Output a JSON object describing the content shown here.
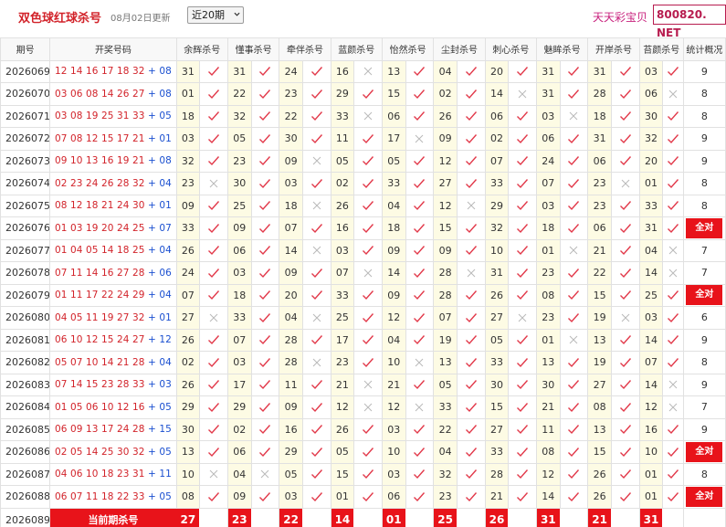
{
  "header": {
    "title": "双色球红球杀号",
    "updated": "08月02日更新",
    "period_select": "近20期",
    "site_name": "天天彩宝贝",
    "site_domain": "800820. NET"
  },
  "colors": {
    "red": "#d2232a",
    "blue": "#1a4fd0",
    "highlight": "#e8131a",
    "cell_bg": "#fdfbe4"
  },
  "columns": [
    "期号",
    "开奖号码",
    "余辉杀号",
    "懂事杀号",
    "牵伴杀号",
    "蓝颜杀号",
    "怡然杀号",
    "尘封杀号",
    "刺心杀号",
    "魅眸杀号",
    "开岸杀号",
    "苔颜杀号",
    "统计概况"
  ],
  "rows": [
    {
      "issue": "2026069",
      "red": "12 14 16 17 18 32",
      "blue": "08",
      "picks": [
        "31",
        "31",
        "24",
        "16",
        "13",
        "04",
        "20",
        "31",
        "31",
        "03"
      ],
      "marks": [
        1,
        1,
        1,
        0,
        1,
        1,
        1,
        1,
        1,
        1
      ],
      "stat": "9"
    },
    {
      "issue": "2026070",
      "red": "03 06 08 14 26 27",
      "blue": "08",
      "picks": [
        "01",
        "22",
        "23",
        "29",
        "15",
        "02",
        "14",
        "31",
        "28",
        "06"
      ],
      "marks": [
        1,
        1,
        1,
        1,
        1,
        1,
        0,
        1,
        1,
        0
      ],
      "stat": "8"
    },
    {
      "issue": "2026071",
      "red": "03 08 19 25 31 33",
      "blue": "05",
      "picks": [
        "18",
        "32",
        "22",
        "33",
        "06",
        "26",
        "06",
        "03",
        "18",
        "30"
      ],
      "marks": [
        1,
        1,
        1,
        0,
        1,
        1,
        1,
        0,
        1,
        1
      ],
      "stat": "8"
    },
    {
      "issue": "2026072",
      "red": "07 08 12 15 17 21",
      "blue": "01",
      "picks": [
        "03",
        "05",
        "30",
        "11",
        "17",
        "09",
        "02",
        "06",
        "31",
        "32"
      ],
      "marks": [
        1,
        1,
        1,
        1,
        0,
        1,
        1,
        1,
        1,
        1
      ],
      "stat": "9"
    },
    {
      "issue": "2026073",
      "red": "09 10 13 16 19 21",
      "blue": "08",
      "picks": [
        "32",
        "23",
        "09",
        "05",
        "05",
        "12",
        "07",
        "24",
        "06",
        "20"
      ],
      "marks": [
        1,
        1,
        0,
        1,
        1,
        1,
        1,
        1,
        1,
        1
      ],
      "stat": "9"
    },
    {
      "issue": "2026074",
      "red": "02 23 24 26 28 32",
      "blue": "04",
      "picks": [
        "23",
        "30",
        "03",
        "02",
        "33",
        "27",
        "33",
        "07",
        "23",
        "01"
      ],
      "marks": [
        0,
        1,
        1,
        1,
        1,
        1,
        1,
        1,
        0,
        1
      ],
      "stat": "8"
    },
    {
      "issue": "2026075",
      "red": "08 12 18 21 24 30",
      "blue": "01",
      "picks": [
        "09",
        "25",
        "18",
        "26",
        "04",
        "12",
        "29",
        "03",
        "23",
        "33"
      ],
      "marks": [
        1,
        1,
        0,
        1,
        1,
        0,
        1,
        1,
        1,
        1
      ],
      "stat": "8"
    },
    {
      "issue": "2026076",
      "red": "01 03 19 20 24 25",
      "blue": "07",
      "picks": [
        "33",
        "09",
        "07",
        "16",
        "18",
        "15",
        "32",
        "18",
        "06",
        "31"
      ],
      "marks": [
        1,
        1,
        1,
        1,
        1,
        1,
        1,
        1,
        1,
        1
      ],
      "stat": "全对"
    },
    {
      "issue": "2026077",
      "red": "01 04 05 14 18 25",
      "blue": "04",
      "picks": [
        "26",
        "06",
        "14",
        "03",
        "09",
        "09",
        "10",
        "01",
        "21",
        "04"
      ],
      "marks": [
        1,
        1,
        0,
        1,
        1,
        1,
        1,
        0,
        1,
        0
      ],
      "stat": "7"
    },
    {
      "issue": "2026078",
      "red": "07 11 14 16 27 28",
      "blue": "06",
      "picks": [
        "24",
        "03",
        "09",
        "07",
        "14",
        "28",
        "31",
        "23",
        "22",
        "14"
      ],
      "marks": [
        1,
        1,
        1,
        0,
        1,
        0,
        1,
        1,
        1,
        0
      ],
      "stat": "7"
    },
    {
      "issue": "2026079",
      "red": "01 11 17 22 24 29",
      "blue": "04",
      "picks": [
        "07",
        "18",
        "20",
        "33",
        "09",
        "28",
        "26",
        "08",
        "15",
        "25"
      ],
      "marks": [
        1,
        1,
        1,
        1,
        1,
        1,
        1,
        1,
        1,
        1
      ],
      "stat": "全对"
    },
    {
      "issue": "2026080",
      "red": "04 05 11 19 27 32",
      "blue": "01",
      "picks": [
        "27",
        "33",
        "04",
        "25",
        "12",
        "07",
        "27",
        "23",
        "19",
        "03"
      ],
      "marks": [
        0,
        1,
        0,
        1,
        1,
        1,
        0,
        1,
        0,
        1
      ],
      "stat": "6"
    },
    {
      "issue": "2026081",
      "red": "06 10 12 15 24 27",
      "blue": "12",
      "picks": [
        "26",
        "07",
        "28",
        "17",
        "04",
        "19",
        "05",
        "01",
        "13",
        "14"
      ],
      "marks": [
        1,
        1,
        1,
        1,
        1,
        1,
        1,
        0,
        1,
        1
      ],
      "stat": "9"
    },
    {
      "issue": "2026082",
      "red": "05 07 10 14 21 28",
      "blue": "04",
      "picks": [
        "02",
        "03",
        "28",
        "23",
        "10",
        "13",
        "33",
        "13",
        "19",
        "07"
      ],
      "marks": [
        1,
        1,
        0,
        1,
        0,
        1,
        1,
        1,
        1,
        1
      ],
      "stat": "8"
    },
    {
      "issue": "2026083",
      "red": "07 14 15 23 28 33",
      "blue": "03",
      "picks": [
        "26",
        "17",
        "11",
        "21",
        "21",
        "05",
        "30",
        "30",
        "27",
        "14"
      ],
      "marks": [
        1,
        1,
        1,
        0,
        1,
        1,
        1,
        1,
        1,
        0
      ],
      "stat": "9"
    },
    {
      "issue": "2026084",
      "red": "01 05 06 10 12 16",
      "blue": "05",
      "picks": [
        "29",
        "29",
        "09",
        "12",
        "12",
        "33",
        "15",
        "21",
        "08",
        "12"
      ],
      "marks": [
        1,
        1,
        1,
        0,
        0,
        1,
        1,
        1,
        1,
        0
      ],
      "stat": "7"
    },
    {
      "issue": "2026085",
      "red": "06 09 13 17 24 28",
      "blue": "15",
      "picks": [
        "30",
        "02",
        "16",
        "26",
        "03",
        "22",
        "27",
        "11",
        "13",
        "16"
      ],
      "marks": [
        1,
        1,
        1,
        1,
        1,
        1,
        1,
        1,
        1,
        1
      ],
      "stat": "9"
    },
    {
      "issue": "2026086",
      "red": "02 05 14 25 30 32",
      "blue": "05",
      "picks": [
        "13",
        "06",
        "29",
        "05",
        "10",
        "04",
        "33",
        "08",
        "15",
        "10"
      ],
      "marks": [
        1,
        1,
        1,
        1,
        1,
        1,
        1,
        1,
        1,
        1
      ],
      "stat": "全对"
    },
    {
      "issue": "2026087",
      "red": "04 06 10 18 23 31",
      "blue": "11",
      "picks": [
        "10",
        "04",
        "05",
        "15",
        "03",
        "32",
        "28",
        "12",
        "26",
        "01"
      ],
      "marks": [
        0,
        0,
        1,
        1,
        1,
        1,
        1,
        1,
        1,
        1
      ],
      "stat": "8"
    },
    {
      "issue": "2026088",
      "red": "06 07 11 18 22 33",
      "blue": "05",
      "picks": [
        "08",
        "09",
        "03",
        "01",
        "06",
        "23",
        "21",
        "14",
        "26",
        "01"
      ],
      "marks": [
        1,
        1,
        1,
        1,
        1,
        1,
        1,
        1,
        1,
        1
      ],
      "stat": "全对"
    }
  ],
  "current": {
    "issue": "2026089",
    "label": "当前期杀号",
    "picks": [
      "27",
      "23",
      "22",
      "14",
      "01",
      "25",
      "26",
      "31",
      "21",
      "31"
    ]
  }
}
